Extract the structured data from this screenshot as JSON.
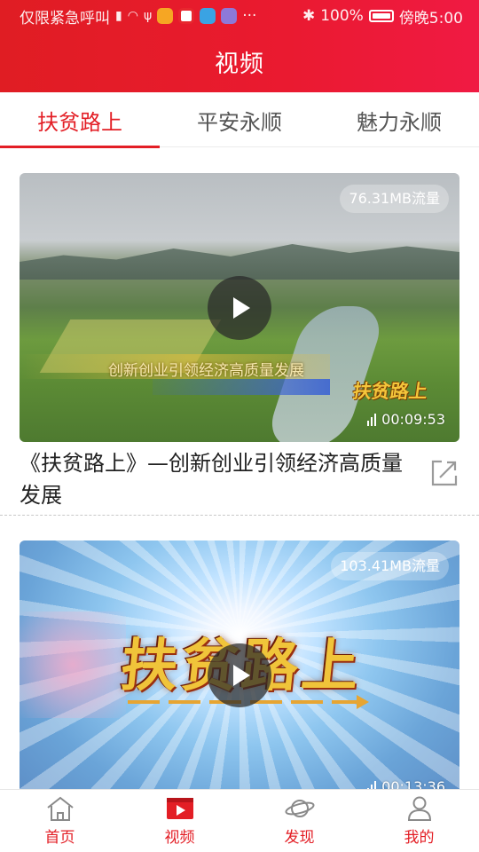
{
  "status_bar": {
    "carrier": "仅限紧急呼叫",
    "battery": "100%",
    "time": "傍晚5:00"
  },
  "header": {
    "title": "视频"
  },
  "tabs": [
    {
      "label": "扶贫路上",
      "active": true
    },
    {
      "label": "平安永顺",
      "active": false
    },
    {
      "label": "魅力永顺",
      "active": false
    }
  ],
  "videos": [
    {
      "title": "《扶贫路上》—创新创业引领经济高质量发展",
      "traffic": "76.31MB流量",
      "duration": "00:09:53",
      "thumb_caption": "创新创业引领经济高质量发展",
      "thumb_logo": "扶贫路上"
    },
    {
      "title": "",
      "traffic": "103.41MB流量",
      "duration": "00:13:36",
      "thumb_logo": "扶贫路上"
    }
  ],
  "bottom_nav": [
    {
      "label": "首页",
      "icon": "home-icon"
    },
    {
      "label": "视频",
      "icon": "video-icon",
      "active": true
    },
    {
      "label": "发现",
      "icon": "planet-icon"
    },
    {
      "label": "我的",
      "icon": "user-icon"
    }
  ],
  "colors": {
    "brand": "#e31e25",
    "header_gradient_end": "#f01a43"
  }
}
